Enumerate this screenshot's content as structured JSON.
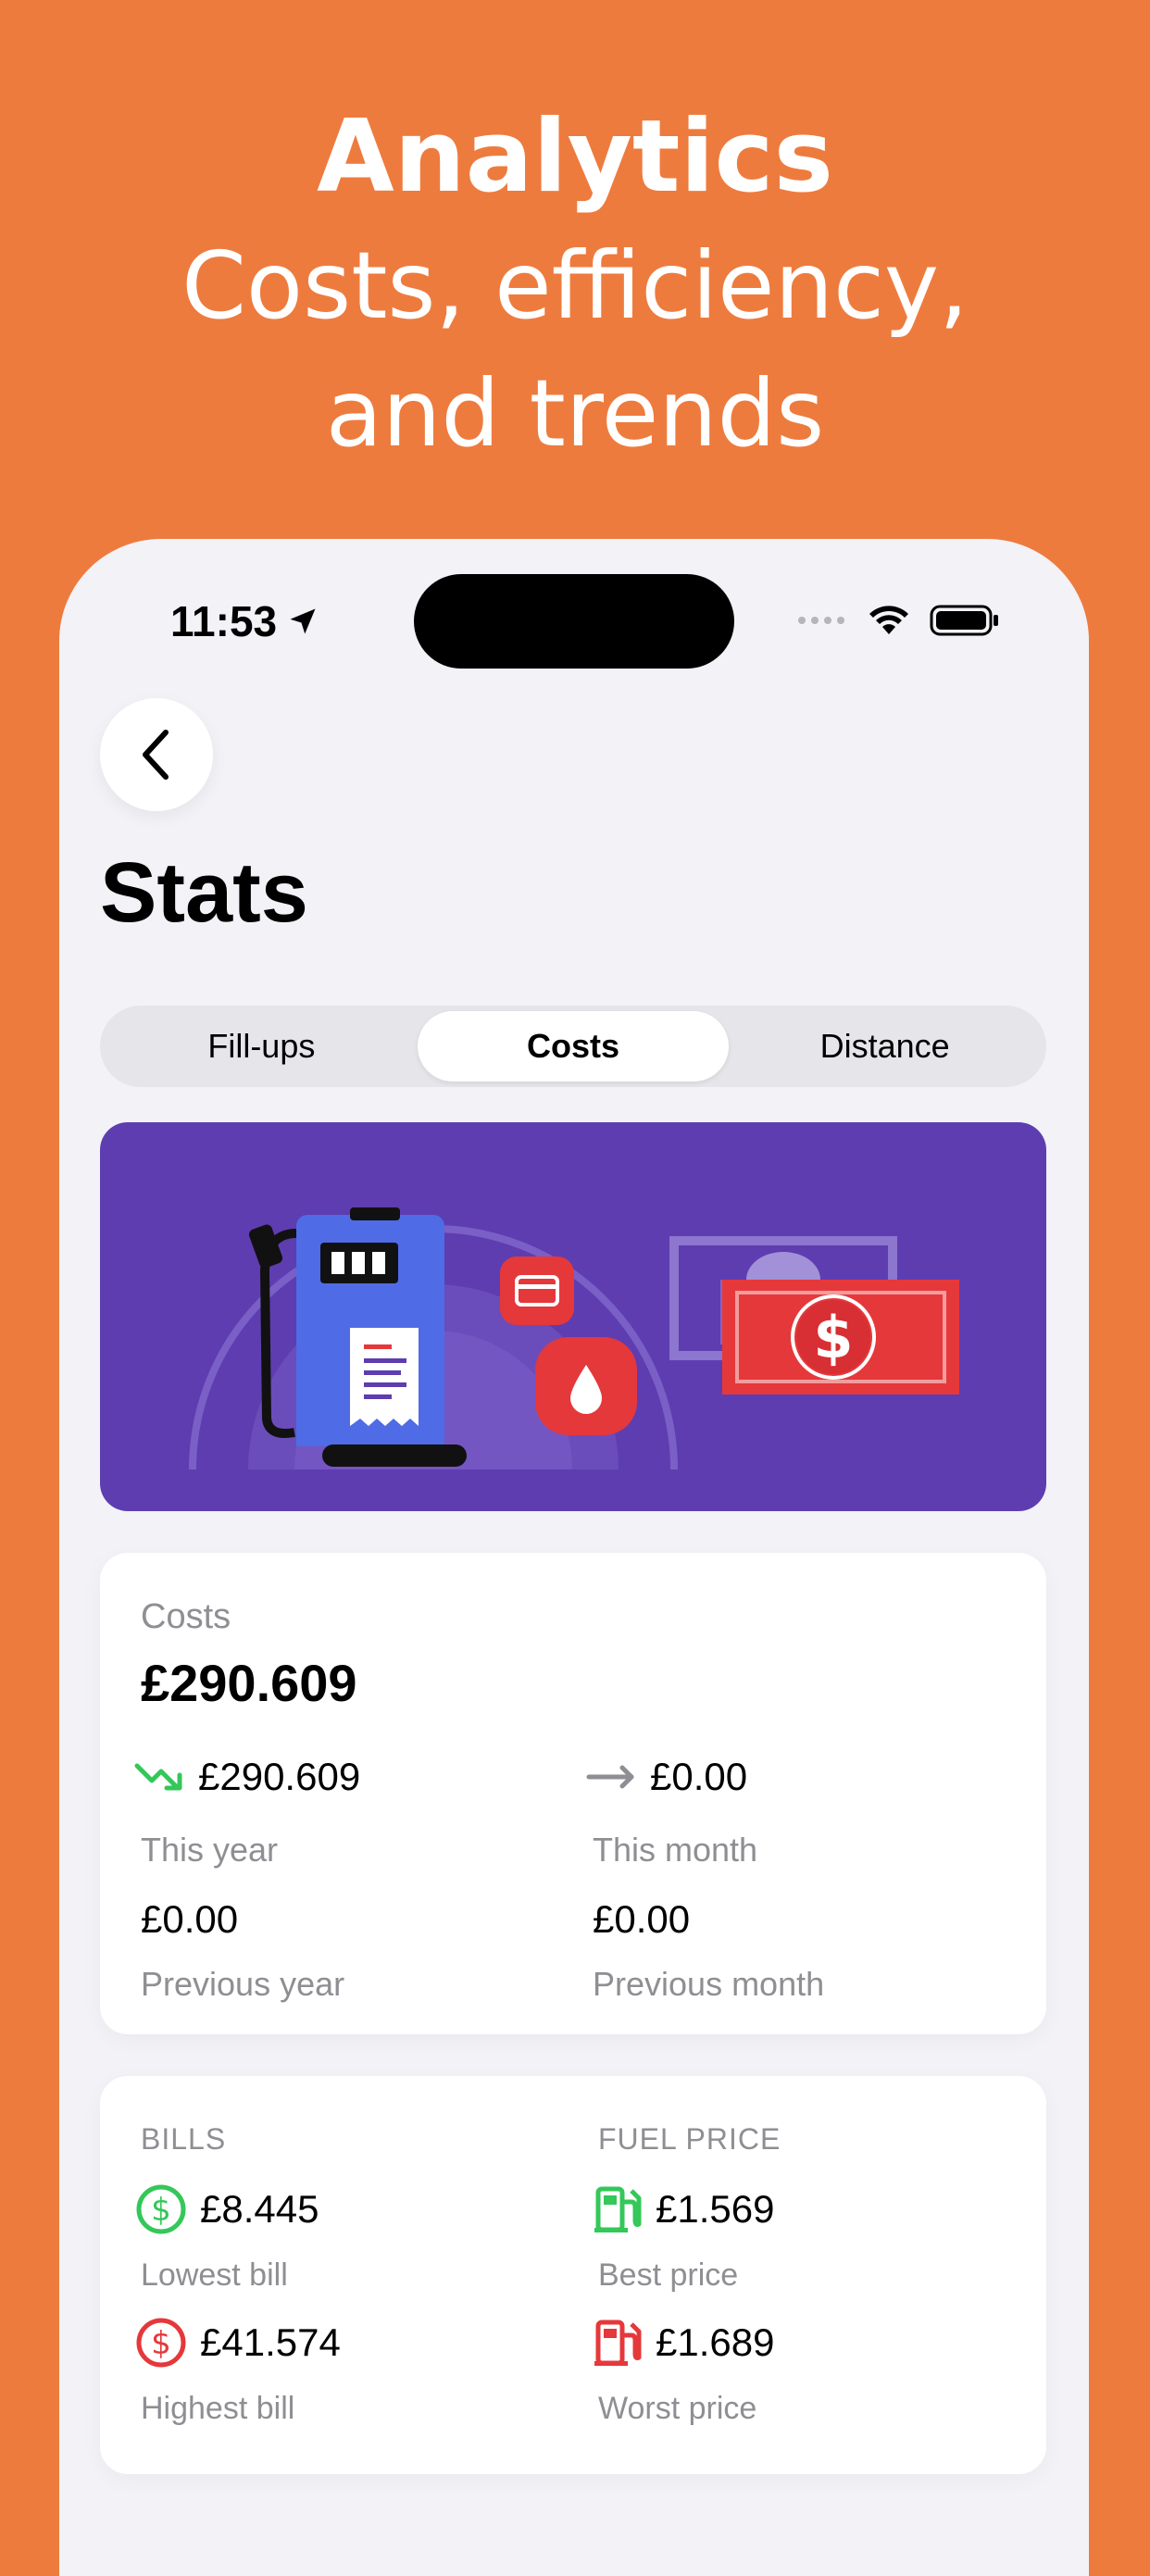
{
  "header": {
    "title": "Analytics",
    "subtitle_line1": "Costs, efficiency,",
    "subtitle_line2": "and trends"
  },
  "status_bar": {
    "time": "11:53"
  },
  "page": {
    "title": "Stats"
  },
  "tabs": [
    {
      "label": "Fill-ups",
      "active": false
    },
    {
      "label": "Costs",
      "active": true
    },
    {
      "label": "Distance",
      "active": false
    }
  ],
  "costs_card": {
    "label": "Costs",
    "total": "£290.609",
    "this_year_value": "£290.609",
    "this_year_label": "This year",
    "this_month_value": "£0.00",
    "this_month_label": "This month",
    "previous_year_value": "£0.00",
    "previous_year_label": "Previous year",
    "previous_month_value": "£0.00",
    "previous_month_label": "Previous month"
  },
  "bills_card": {
    "bills_heading": "BILLS",
    "fuel_heading": "FUEL PRICE",
    "lowest_bill_value": "£8.445",
    "lowest_bill_label": "Lowest bill",
    "highest_bill_value": "£41.574",
    "highest_bill_label": "Highest bill",
    "best_price_value": "£1.569",
    "best_price_label": "Best price",
    "worst_price_value": "£1.689",
    "worst_price_label": "Worst price"
  },
  "colors": {
    "background": "#EE7B3E",
    "banner": "#5E3DB0",
    "green": "#34C759",
    "red": "#E5383B"
  }
}
